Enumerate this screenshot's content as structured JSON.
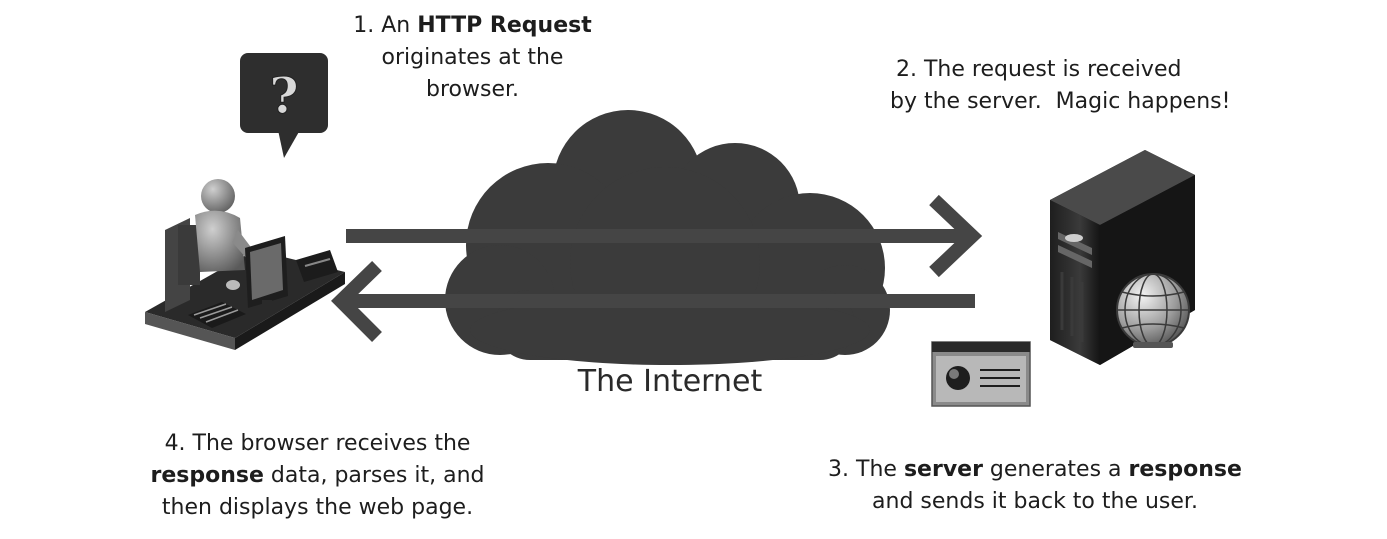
{
  "step1": {
    "prefix": "1. An ",
    "bold": "HTTP Request",
    "line2": "originates at the",
    "line3": "browser."
  },
  "step2": {
    "line1": "2. The request is received",
    "line2": "by the server.  Magic happens!"
  },
  "step3": {
    "prefix": "3. The ",
    "bold1": "server",
    "middle": " generates a ",
    "bold2": "response",
    "line2": "and sends it back to the user."
  },
  "step4": {
    "line1": "4. The browser receives the",
    "bold": "response",
    "line2_rest": " data, parses it, and",
    "line3": "then displays the web page."
  },
  "cloud_label": "The Internet",
  "speech_bubble_text": "?",
  "colors": {
    "cloud": "#3b3b3b",
    "arrow": "#454545",
    "server": "#2b2b2b",
    "text": "#1d1d1d"
  },
  "icons": [
    "user-at-computer-icon",
    "speech-bubble-icon",
    "cloud-icon",
    "server-tower-icon",
    "globe-icon",
    "web-page-icon"
  ]
}
